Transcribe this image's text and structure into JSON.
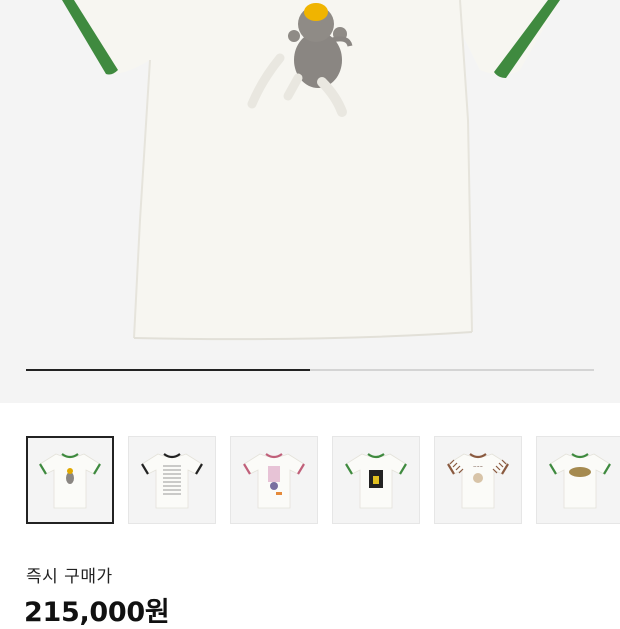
{
  "gallery": {
    "current_image": "white ringer t-shirt with sock monkey print",
    "progress_fraction": 0.5,
    "thumbnails": [
      {
        "name": "thumb-green-ringer-monkey",
        "trim": "#3f8a3f",
        "print": "monkey",
        "selected": true
      },
      {
        "name": "thumb-black-ringer-text",
        "trim": "#222222",
        "print": "text",
        "selected": false
      },
      {
        "name": "thumb-pink-ringer-figure",
        "trim": "#c0607a",
        "print": "pink-figure",
        "selected": false
      },
      {
        "name": "thumb-green-ringer-photo",
        "trim": "#3f8a3f",
        "print": "dark-photo",
        "selected": false
      },
      {
        "name": "thumb-brown-ringer-striped",
        "trim": "#8a5a40",
        "print": "striped",
        "selected": false
      },
      {
        "name": "thumb-green-ringer-oval",
        "trim": "#3f8a3f",
        "print": "oval",
        "selected": false
      }
    ]
  },
  "price": {
    "label": "즉시 구매가",
    "value": "215,000원"
  },
  "colors": {
    "hero_background": "#f4f4f4",
    "shirt": "#f7f6f1",
    "ringer_green": "#3f8a3f"
  }
}
